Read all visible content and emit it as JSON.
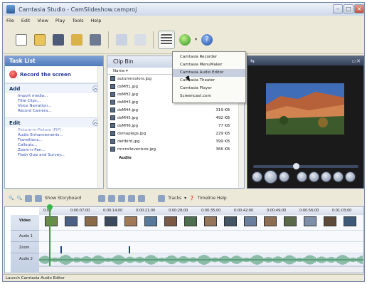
{
  "window": {
    "title": "Camtasia Studio - CamSlideshow.camproj"
  },
  "menu": [
    "File",
    "Edit",
    "View",
    "Play",
    "Tools",
    "Help"
  ],
  "task_list": {
    "title": "Task List",
    "record_label": "Record the screen",
    "groups": [
      {
        "title": "Add",
        "items": [
          "Import media...",
          "Title Clips...",
          "Voice Narration...",
          "Record Camera..."
        ]
      },
      {
        "title": "Edit",
        "items": [
          "Picture-in-Picture (PIP)",
          "Audio Enhancements...",
          "Transitions...",
          "Callouts...",
          "Zoom-n-Pan...",
          "Flash Quiz and Survey..."
        ]
      }
    ]
  },
  "clip_bin": {
    "title": "Clip Bin",
    "column_name": "Name",
    "files": [
      {
        "name": "autumncolors.jpg",
        "size": ""
      },
      {
        "name": "dsMH1.jpg",
        "size": "..."
      },
      {
        "name": "dsMH2.jpg",
        "size": "..."
      },
      {
        "name": "dsMH3.jpg",
        "size": "379 KB"
      },
      {
        "name": "dsMH4.jpg",
        "size": "319 KB"
      },
      {
        "name": "dsMH5.jpg",
        "size": "492 KB"
      },
      {
        "name": "dsMH6.jpg",
        "size": "77 KB"
      },
      {
        "name": "dsmaplegs.jpg",
        "size": "229 KB"
      },
      {
        "name": "deltbird.jpg",
        "size": "399 KB"
      },
      {
        "name": "mrcrolleventure.jpg",
        "size": "366 KB"
      }
    ],
    "section_label": "Audio"
  },
  "dropdown": {
    "items": [
      "Camtasia Recorder",
      "Camtasia MenuMaker",
      "Camtasia Audio Editor",
      "Camtasia Theater",
      "Camtasia Player",
      "Screencast.com"
    ],
    "selected_index": 2
  },
  "timeline_toolbar": {
    "storyboard_label": "Show Storyboard",
    "tracks_label": "Tracks",
    "help_label": "Timeline Help"
  },
  "ruler_ticks": [
    "0:00",
    "0:00:07;00",
    "0:00:14;00",
    "0:00:21;00",
    "0:00:28;00",
    "0:00:35;00",
    "0:00:42;00",
    "0:00:49;00",
    "0:00:56;00",
    "0:01:03;00"
  ],
  "tracks": [
    "Video",
    "Audio 1",
    "Zoom",
    "Audio 2"
  ],
  "status_text": "Launch Camtasia Audio Editor",
  "colors": {
    "accent": "#4f7ab8",
    "record": "#c2141a",
    "link": "#3550b8",
    "playhead": "#3aa23a"
  }
}
